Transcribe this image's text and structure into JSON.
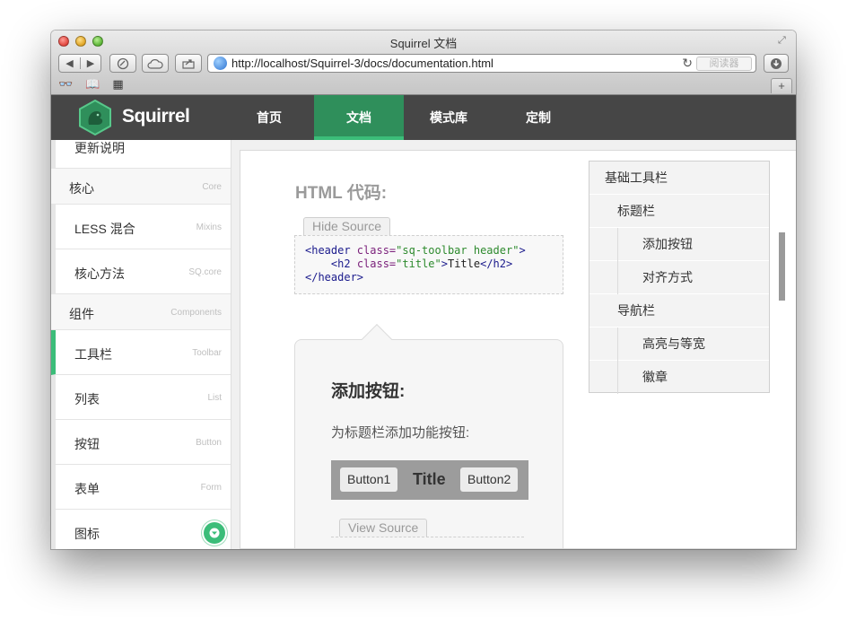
{
  "browser": {
    "window_title": "Squirrel 文档",
    "url": "http://localhost/Squirrel-3/docs/documentation.html",
    "reader_label": "阅读器",
    "back_icon": "◀",
    "forward_icon": "▶",
    "newtab_label": "+"
  },
  "site": {
    "logo_text": "Squirrel",
    "nav": [
      {
        "label": "首页"
      },
      {
        "label": "文档"
      },
      {
        "label": "模式库"
      },
      {
        "label": "定制"
      }
    ],
    "active_nav": "文档",
    "accent_color": "#3bbd79"
  },
  "sidebar": {
    "top_item": "更新说明",
    "groups": {
      "core": {
        "label": "核心",
        "sub": "Core"
      },
      "components": {
        "label": "组件",
        "sub": "Components"
      }
    },
    "items": [
      {
        "label": "LESS 混合",
        "sub": "Mixins"
      },
      {
        "label": "核心方法",
        "sub": "SQ.core"
      },
      {
        "label": "工具栏",
        "sub": "Toolbar"
      },
      {
        "label": "列表",
        "sub": "List"
      },
      {
        "label": "按钮",
        "sub": "Button"
      },
      {
        "label": "表单",
        "sub": "Form"
      },
      {
        "label": "图标",
        "sub": ""
      }
    ],
    "active_item": "工具栏"
  },
  "content": {
    "html_title": "HTML 代码:",
    "hide_source": "Hide Source",
    "code": {
      "l1_open": "<header ",
      "l1_attr": "class=",
      "l1_val": "\"sq-toolbar header\"",
      "l1_close": ">",
      "l2_indent": "    ",
      "l2_open": "<h2 ",
      "l2_attr": "class=",
      "l2_val": "\"title\"",
      "l2_gt": ">",
      "l2_text": "Title",
      "l2_close": "</h2>",
      "l3": "</header>"
    },
    "demo_heading": "添加按钮:",
    "demo_desc": "为标题栏添加功能按钮:",
    "demo_button1": "Button1",
    "demo_title": "Title",
    "demo_button2": "Button2",
    "view_source": "View Source"
  },
  "toc": [
    {
      "label": "基础工具栏",
      "level": 1
    },
    {
      "label": "标题栏",
      "level": 2
    },
    {
      "label": "添加按钮",
      "level": 3
    },
    {
      "label": "对齐方式",
      "level": 3
    },
    {
      "label": "导航栏",
      "level": 2
    },
    {
      "label": "高亮与等宽",
      "level": 3
    },
    {
      "label": "徽章",
      "level": 3
    }
  ]
}
